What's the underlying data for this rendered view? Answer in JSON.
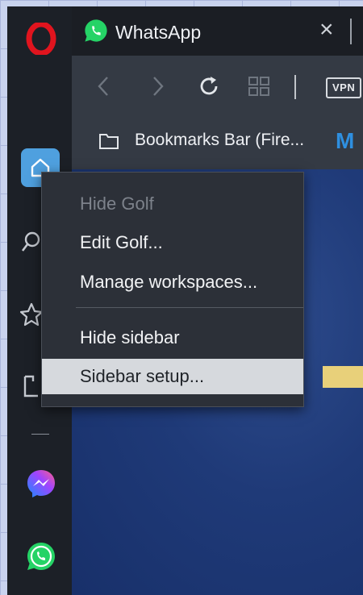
{
  "tab": {
    "title": "WhatsApp",
    "close": "×"
  },
  "toolbar": {
    "vpn_label": "VPN"
  },
  "bookmarks": {
    "label": "Bookmarks Bar (Fire...",
    "next_glyph": "M"
  },
  "sidebar": {
    "items": [
      {
        "icon": "opera-logo-icon"
      },
      {
        "icon": "home-icon",
        "active": true
      },
      {
        "icon": "search-icon"
      },
      {
        "icon": "star-icon"
      },
      {
        "icon": "clipboard-icon"
      },
      {
        "icon": "messenger-icon"
      },
      {
        "icon": "whatsapp-icon"
      }
    ]
  },
  "context_menu": {
    "items": [
      {
        "label": "Hide Golf",
        "disabled": true
      },
      {
        "label": "Edit Golf..."
      },
      {
        "label": "Manage workspaces..."
      },
      {
        "label": "Hide sidebar"
      },
      {
        "label": "Sidebar setup...",
        "highlighted": true
      }
    ]
  },
  "colors": {
    "accent": "#4fa0df",
    "opera_red": "#e0141e",
    "whatsapp_green": "#25d366",
    "menu_bg": "#2c3038",
    "menu_highlight": "#d6d9dd"
  }
}
